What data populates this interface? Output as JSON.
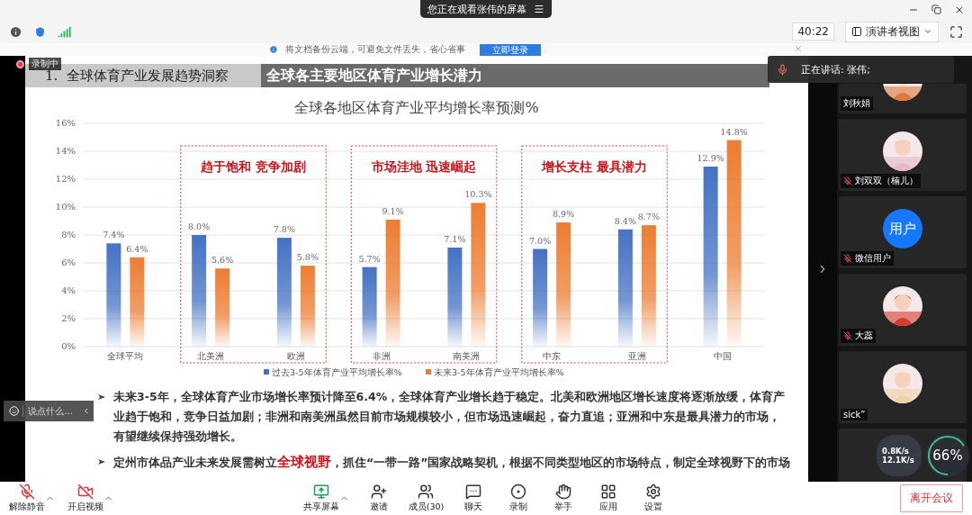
{
  "top_bar": {
    "screen_share_banner": "您正在观看张伟的屏幕",
    "timer": "40:22",
    "view_mode": "演讲者视图"
  },
  "notice": {
    "text": "将文档备份云端，可避免文件丢失，省心省事",
    "button": "立即登录"
  },
  "recording": {
    "label": "录制中"
  },
  "slide": {
    "section": "1.  全球体育产业发展趋势洞察",
    "title": "全球各主要地区体育产业增长潜力",
    "chart_data": {
      "type": "bar",
      "title": "全球各地区体育产业平均增长率预测%",
      "categories": [
        "全球平均",
        "北美洲",
        "欧洲",
        "非洲",
        "南美洲",
        "中东",
        "亚洲",
        "中国"
      ],
      "series": [
        {
          "name": "过去3-5年体育产业平均增长率%",
          "color": "#4472c4",
          "values": [
            7.4,
            8.0,
            7.8,
            5.7,
            7.1,
            7.0,
            8.4,
            12.9
          ]
        },
        {
          "name": "未来3-5年体育产业平均增长率%",
          "color": "#ed7d31",
          "values": [
            6.4,
            5.6,
            5.8,
            9.1,
            10.3,
            8.9,
            8.7,
            14.8
          ]
        }
      ],
      "ylim": [
        0,
        16
      ],
      "yticks": [
        {
          "value": 0,
          "label": "0%"
        },
        {
          "value": 2,
          "label": "2%"
        },
        {
          "value": 4,
          "label": "4%"
        },
        {
          "value": 6,
          "label": "6%"
        },
        {
          "value": 8,
          "label": "8%"
        },
        {
          "value": 10,
          "label": "10%"
        },
        {
          "value": 12,
          "label": "12%"
        },
        {
          "value": 14,
          "label": "14%"
        },
        {
          "value": 16,
          "label": "16%"
        }
      ],
      "value_labels": [
        [
          "7.4%",
          "8.0%",
          "7.8%",
          "5.7%",
          "7.1%",
          "7.0%",
          "8.4%",
          "12.9%"
        ],
        [
          "6.4%",
          "5.6%",
          "5.8%",
          "9.1%",
          "10.3%",
          "8.9%",
          "8.7%",
          "14.8%"
        ]
      ],
      "grid": true,
      "legend": "bottom",
      "annotations": [
        "趋于饱和  竞争加剧",
        "市场洼地  迅速崛起",
        "增长支柱  最具潜力"
      ]
    },
    "bullets": [
      "未来3-5年，全球体育产业市场增长率预计降至6.4%，全球体育产业增长趋于稳定。北美和欧洲地区增长速度将逐渐放缓，体育产业趋于饱和，竞争日益加剧；非洲和南美洲虽然目前市场规模较小，但市场迅速崛起，奋力直追；亚洲和中东是最具潜力的市场，有望继续保持强劲增长。",
      "定州市体品产业未来发展需树立**全球视野**，抓住“一带一路”国家战略契机，根据不同类型地区的市场特点，制定全球视野下的市场"
    ]
  },
  "chat_input": {
    "placeholder": "说点什么..."
  },
  "speaking_toast": {
    "text": "正在讲话: 张伟;"
  },
  "participants": [
    {
      "kind": "picture",
      "name": "刘秋娟",
      "muted": false
    },
    {
      "kind": "picture",
      "name": "刘双双（楠儿）",
      "muted": true
    },
    {
      "kind": "initials",
      "name": "微信用户",
      "muted": true,
      "initials": "用户"
    },
    {
      "kind": "picture",
      "name": "大蕊",
      "muted": true
    },
    {
      "kind": "picture",
      "name": "sick”",
      "muted": false
    },
    {
      "kind": "empty"
    }
  ],
  "network_widget": {
    "upload": "0.8K/s",
    "download": "12.1K/s",
    "cpu": "66%"
  },
  "toolbar": {
    "items": [
      {
        "kind": "mic",
        "label": "解除静音",
        "on": false,
        "caret": true
      },
      {
        "kind": "video",
        "label": "开启视频",
        "on": false,
        "caret": true
      },
      {
        "kind": "share",
        "label": "共享屏幕",
        "caret": true
      },
      {
        "kind": "invite",
        "label": "邀请",
        "caret": false
      },
      {
        "kind": "members",
        "label": "成员(30)",
        "caret": false
      },
      {
        "kind": "chat",
        "label": "聊天",
        "caret": false
      },
      {
        "kind": "record",
        "label": "录制",
        "caret": false
      },
      {
        "kind": "hand",
        "label": "举手",
        "caret": false
      },
      {
        "kind": "apps",
        "label": "应用",
        "caret": false
      },
      {
        "kind": "settings",
        "label": "设置",
        "caret": false
      }
    ],
    "leave_button": "离开会议"
  }
}
